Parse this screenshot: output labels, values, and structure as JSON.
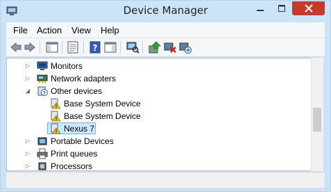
{
  "window": {
    "title": "Device Manager"
  },
  "controls": {
    "minimize": "minimize",
    "maximize": "maximize",
    "close": "close"
  },
  "menu": [
    {
      "label": "File"
    },
    {
      "label": "Action"
    },
    {
      "label": "View"
    },
    {
      "label": "Help"
    }
  ],
  "toolbar": {
    "icons": [
      "back-arrow-icon",
      "forward-arrow-icon",
      "show-hide-console-tree-icon",
      "properties-icon",
      "help-icon",
      "action-pane-icon",
      "scan-hardware-icon",
      "update-driver-icon",
      "uninstall-device-icon",
      "add-legacy-hardware-icon"
    ]
  },
  "tree": {
    "items": [
      {
        "label": "Monitors",
        "icon": "monitor-icon",
        "expander": "collapsed"
      },
      {
        "label": "Network adapters",
        "icon": "network-adapter-icon",
        "expander": "collapsed"
      },
      {
        "label": "Other devices",
        "icon": "other-devices-icon",
        "expander": "expanded"
      },
      {
        "label": "Base System Device",
        "icon": "warning-device-icon",
        "expander": "none"
      },
      {
        "label": "Base System Device",
        "icon": "warning-device-icon",
        "expander": "none"
      },
      {
        "label": "Nexus 7",
        "icon": "warning-device-icon",
        "expander": "none",
        "selected": true
      },
      {
        "label": "Portable Devices",
        "icon": "portable-device-icon",
        "expander": "collapsed"
      },
      {
        "label": "Print queues",
        "icon": "printer-icon",
        "expander": "collapsed"
      },
      {
        "label": "Processors",
        "icon": "processor-icon",
        "expander": "collapsed"
      }
    ]
  },
  "colors": {
    "close_button": "#c7392b",
    "selection": "#cce8ff",
    "warning": "#f2c811"
  }
}
